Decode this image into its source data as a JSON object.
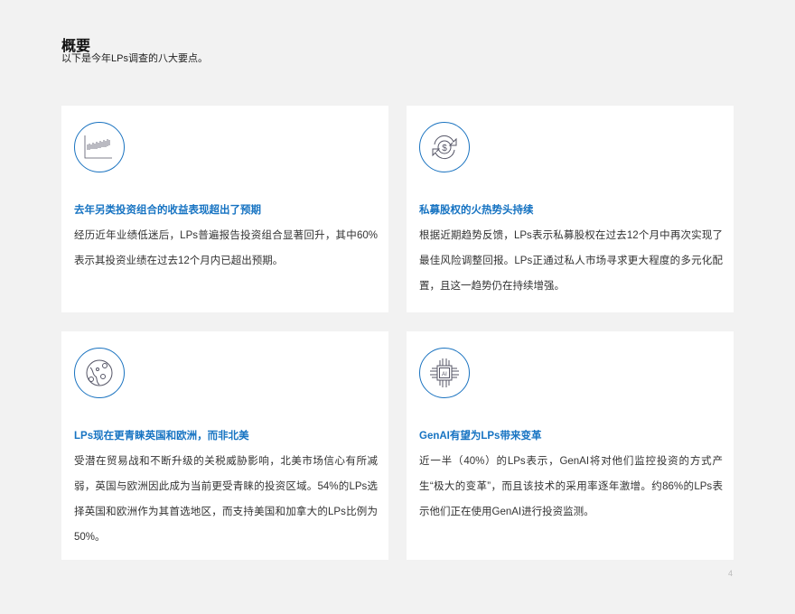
{
  "header": {
    "title": "概要",
    "subtitle": "以下是今年LPs调查的八大要点。"
  },
  "cards": [
    {
      "icon": "bar-chart-icon",
      "title": "去年另类投资组合的收益表现超出了预期",
      "body": "经历近年业绩低迷后，LPs普遍报告投资组合显著回升，其中60%表示其投资业绩在过去12个月内已超出预期。"
    },
    {
      "icon": "dollar-exchange-icon",
      "title": "私募股权的火热势头持续",
      "body": "根据近期趋势反馈，LPs表示私募股权在过去12个月中再次实现了最佳风险调整回报。LPs正通过私人市场寻求更大程度的多元化配置，且这一趋势仍在持续增强。"
    },
    {
      "icon": "globe-icon",
      "title": "LPs现在更青睐英国和欧洲，而非北美",
      "body": "受潜在贸易战和不断升级的关税威胁影响，北美市场信心有所减弱，英国与欧洲因此成为当前更受青睐的投资区域。54%的LPs选择英国和欧洲作为其首选地区，而支持美国和加拿大的LPs比例为50%。"
    },
    {
      "icon": "ai-chip-icon",
      "title": "GenAI有望为LPs带来变革",
      "body": "近一半（40%）的LPs表示，GenAI将对他们监控投资的方式产生“极大的变革”，而且该技术的采用率逐年激增。约86%的LPs表示他们正在使用GenAI进行投资监测。",
      "chip_label": "AI"
    }
  ],
  "page_number": "4",
  "colors": {
    "accent": "#1673c2",
    "background": "#f2f2f2",
    "card": "#ffffff"
  }
}
